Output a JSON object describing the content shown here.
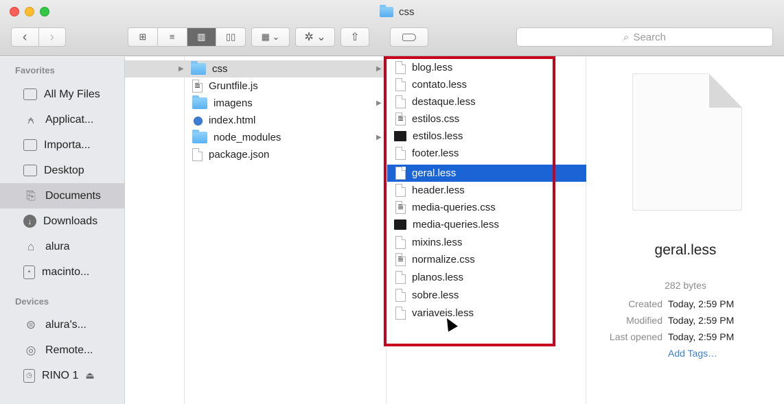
{
  "window": {
    "title": "css",
    "search_placeholder": "Search",
    "toolbar": {
      "back": "‹",
      "forward": "›",
      "views": [
        "⊞",
        "≡",
        "▥",
        "▯▯"
      ],
      "arrange": "▦ ⌄",
      "action": "✲ ⌄",
      "share": "⇧"
    }
  },
  "sidebar": {
    "favorites_header": "Favorites",
    "favorites": [
      {
        "label": "All My Files",
        "icon": "all-files-icon"
      },
      {
        "label": "Applicat...",
        "icon": "applications-icon"
      },
      {
        "label": "Importa...",
        "icon": "folder-icon"
      },
      {
        "label": "Desktop",
        "icon": "desktop-icon"
      },
      {
        "label": "Documents",
        "icon": "documents-icon"
      },
      {
        "label": "Downloads",
        "icon": "downloads-icon"
      },
      {
        "label": "alura",
        "icon": "home-icon"
      },
      {
        "label": "macinto...",
        "icon": "disk-icon"
      }
    ],
    "devices_header": "Devices",
    "devices": [
      {
        "label": "alura's...",
        "icon": "computer-icon"
      },
      {
        "label": "Remote...",
        "icon": "remote-disc-icon"
      },
      {
        "label": "RINO 1",
        "icon": "time-machine-icon",
        "eject": "⏏"
      }
    ]
  },
  "column2": [
    {
      "name": "css",
      "type": "folder",
      "expanded": true
    },
    {
      "name": "Gruntfile.js",
      "type": "doc"
    },
    {
      "name": "imagens",
      "type": "folder"
    },
    {
      "name": "index.html",
      "type": "html"
    },
    {
      "name": "node_modules",
      "type": "folder"
    },
    {
      "name": "package.json",
      "type": "file"
    }
  ],
  "column3": [
    {
      "name": "blog.less",
      "type": "file"
    },
    {
      "name": "contato.less",
      "type": "file"
    },
    {
      "name": "destaque.less",
      "type": "file"
    },
    {
      "name": "estilos.css",
      "type": "doc"
    },
    {
      "name": "estilos.less",
      "type": "term"
    },
    {
      "name": "footer.less",
      "type": "file"
    },
    {
      "name": "geral.less",
      "type": "file",
      "selected": true
    },
    {
      "name": "header.less",
      "type": "file"
    },
    {
      "name": "media-queries.css",
      "type": "doc"
    },
    {
      "name": "media-queries.less",
      "type": "term"
    },
    {
      "name": "mixins.less",
      "type": "file"
    },
    {
      "name": "normalize.css",
      "type": "doc"
    },
    {
      "name": "planos.less",
      "type": "file"
    },
    {
      "name": "sobre.less",
      "type": "file"
    },
    {
      "name": "variaveis.less",
      "type": "file"
    }
  ],
  "preview": {
    "name": "geral.less",
    "size": "282 bytes",
    "created_label": "Created",
    "created": "Today, 2:59 PM",
    "modified_label": "Modified",
    "modified": "Today, 2:59 PM",
    "opened_label": "Last opened",
    "opened": "Today, 2:59 PM",
    "add_tags": "Add Tags…"
  },
  "colors": {
    "selection": "#1a64d6",
    "annotation": "#c8001e",
    "link": "#3a7fd5"
  }
}
